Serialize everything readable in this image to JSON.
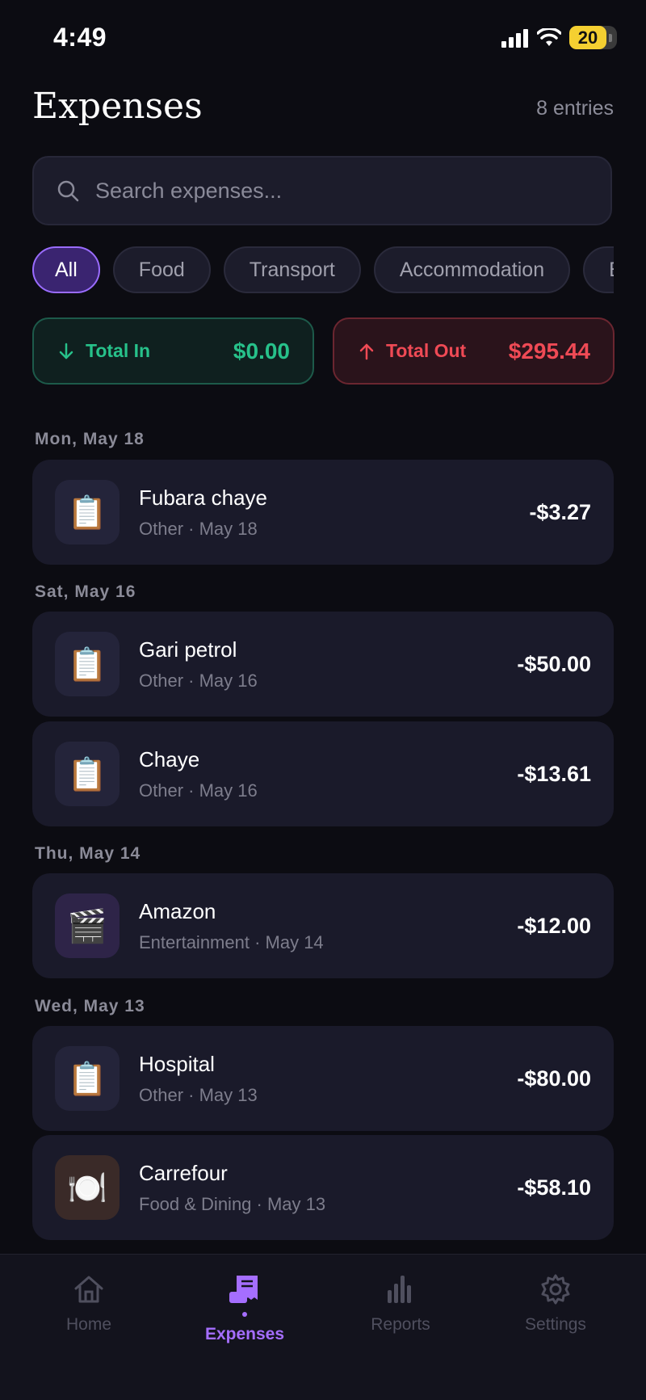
{
  "status_bar": {
    "time": "4:49",
    "battery": "20"
  },
  "header": {
    "title": "Expenses",
    "entries": "8 entries"
  },
  "search": {
    "placeholder": "Search expenses..."
  },
  "filters": [
    "All",
    "Food",
    "Transport",
    "Accommodation",
    "Entertainment"
  ],
  "active_filter": "All",
  "totals": {
    "in_label": "Total In",
    "in_value": "$0.00",
    "out_label": "Total Out",
    "out_value": "$295.44"
  },
  "groups": [
    {
      "date": "Mon, May 18",
      "items": [
        {
          "title": "Fubara chaye",
          "sub": "Other · May 18",
          "amount": "-$3.27",
          "icon": "clipboard-icon"
        }
      ]
    },
    {
      "date": "Sat, May 16",
      "items": [
        {
          "title": "Gari petrol",
          "sub": "Other · May 16",
          "amount": "-$50.00",
          "icon": "clipboard-icon"
        },
        {
          "title": "Chaye",
          "sub": "Other · May 16",
          "amount": "-$13.61",
          "icon": "clipboard-icon"
        }
      ]
    },
    {
      "date": "Thu, May 14",
      "items": [
        {
          "title": "Amazon",
          "sub": "Entertainment · May 14",
          "amount": "-$12.00",
          "icon": "clapperboard-icon"
        }
      ]
    },
    {
      "date": "Wed, May 13",
      "items": [
        {
          "title": "Hospital",
          "sub": "Other · May 13",
          "amount": "-$80.00",
          "icon": "clipboard-icon"
        },
        {
          "title": "Carrefour",
          "sub": "Food & Dining · May 13",
          "amount": "-$58.10",
          "icon": "plate-icon"
        }
      ]
    }
  ],
  "nav": {
    "home": "Home",
    "expenses": "Expenses",
    "reports": "Reports",
    "settings": "Settings"
  },
  "colors": {
    "accent": "#a56eff",
    "income": "#27c18a",
    "expense": "#ef4a55",
    "background": "#0c0c12"
  }
}
